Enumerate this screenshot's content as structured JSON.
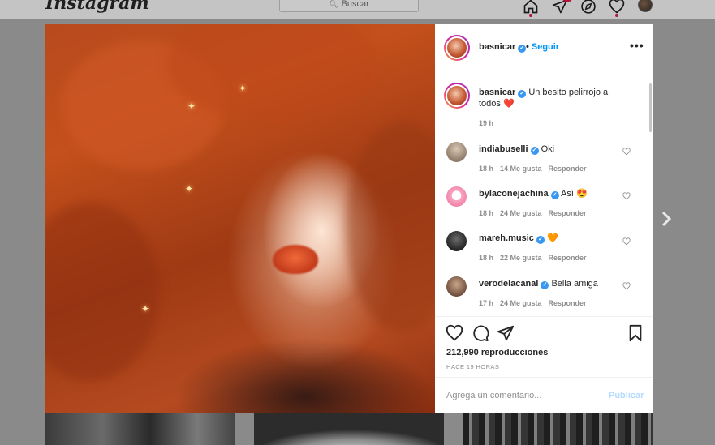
{
  "topbar": {
    "logo": "Instagram",
    "search_placeholder": "Buscar",
    "icons": [
      "home-icon",
      "direct-icon",
      "explore-icon",
      "activity-heart-icon",
      "profile-avatar"
    ]
  },
  "post": {
    "owner": {
      "username": "basnicar",
      "verified": true,
      "follow_label": "Seguir",
      "separator": "•"
    },
    "more_label": "•••",
    "caption": {
      "username": "basnicar",
      "text": "Un besito pelirrojo a todos",
      "emoji": "❤️",
      "time": "19 h"
    },
    "comments": [
      {
        "username": "indiabuselli",
        "text": "Oki",
        "time": "18 h",
        "likes": "14 Me gusta",
        "reply": "Responder"
      },
      {
        "username": "bylaconejachina",
        "text": "Así",
        "emoji": "😍",
        "time": "18 h",
        "likes": "24 Me gusta",
        "reply": "Responder"
      },
      {
        "username": "mareh.music",
        "text": "",
        "emoji": "🧡",
        "time": "18 h",
        "likes": "22 Me gusta",
        "reply": "Responder"
      },
      {
        "username": "verodelacanal",
        "text": "Bella amiga",
        "time": "17 h",
        "likes": "24 Me gusta",
        "reply": "Responder"
      }
    ],
    "views": "212,990 reproducciones",
    "posted_ago": "HACE 19 HORAS",
    "comment_placeholder": "Agrega un comentario...",
    "publish_label": "Publicar"
  },
  "colors": {
    "accent": "#0095f6",
    "verified": "#3897f0",
    "heart": "#ed4956",
    "overlay": "#8a8a8a"
  }
}
